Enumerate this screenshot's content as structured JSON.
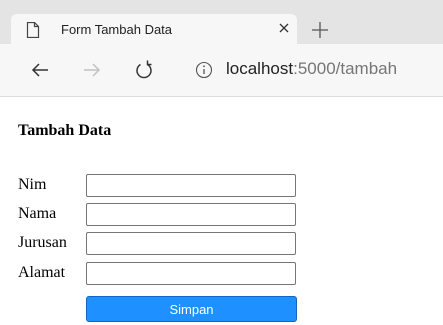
{
  "browser": {
    "tab": {
      "title": "Form Tambah Data",
      "icon": "page-icon",
      "close_icon": "close-icon"
    },
    "new_tab_icon": "plus-icon",
    "toolbar": {
      "back_icon": "back-arrow-icon",
      "forward_icon": "forward-arrow-icon",
      "refresh_icon": "refresh-icon",
      "info_icon": "info-icon"
    },
    "address": {
      "host": "localhost",
      "path": ":5000/tambah"
    }
  },
  "page": {
    "title": "Tambah Data",
    "form": {
      "fields": [
        {
          "label": "Nim",
          "value": ""
        },
        {
          "label": "Nama",
          "value": ""
        },
        {
          "label": "Jurusan",
          "value": ""
        },
        {
          "label": "Alamat",
          "value": ""
        }
      ],
      "submit_label": "Simpan"
    }
  },
  "colors": {
    "tab_strip_bg": "#e4e4e4",
    "toolbar_bg": "#f7f7f7",
    "submit_button": "#1e90ff",
    "url_path": "#767676"
  }
}
